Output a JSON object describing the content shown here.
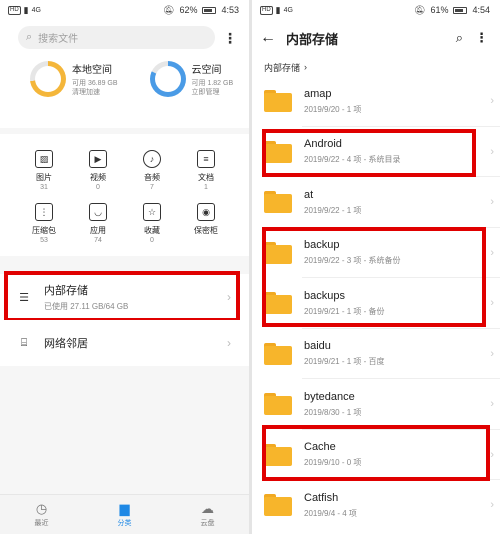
{
  "left_screen": {
    "status": {
      "tag": "HD",
      "net": "4G",
      "battery": "62%",
      "time": "4:53"
    },
    "search": {
      "placeholder": "搜索文件"
    },
    "storage": [
      {
        "title": "本地空间",
        "line1": "可用 36.89 GB",
        "line2": "清理加速",
        "ring_color": "#f4b63a",
        "used_fraction": 0.73
      },
      {
        "title": "云空间",
        "line1": "可用 1.82 GB",
        "line2": "立即管理",
        "ring_color": "#4a9be6",
        "used_fraction": 0.82
      }
    ],
    "categories": [
      {
        "label": "图片",
        "count": "31",
        "icon": "image-icon"
      },
      {
        "label": "视频",
        "count": "0",
        "icon": "video-icon"
      },
      {
        "label": "音频",
        "count": "7",
        "icon": "audio-icon"
      },
      {
        "label": "文档",
        "count": "1",
        "icon": "document-icon"
      },
      {
        "label": "压缩包",
        "count": "53",
        "icon": "archive-icon"
      },
      {
        "label": "应用",
        "count": "74",
        "icon": "app-icon"
      },
      {
        "label": "收藏",
        "count": "0",
        "icon": "star-icon"
      },
      {
        "label": "保密柜",
        "count": "",
        "icon": "safe-icon"
      }
    ],
    "internal_storage": {
      "title": "内部存储",
      "subtitle": "已使用 27.11 GB/64 GB"
    },
    "network": {
      "title": "网络邻居"
    },
    "tabs": [
      {
        "label": "最近",
        "icon": "clock-icon",
        "active": false
      },
      {
        "label": "分类",
        "icon": "folder-icon",
        "active": true
      },
      {
        "label": "云盘",
        "icon": "cloud-icon",
        "active": false
      }
    ]
  },
  "right_screen": {
    "status": {
      "tag": "HD",
      "net": "4G",
      "battery": "61%",
      "time": "4:54"
    },
    "title": "内部存储",
    "breadcrumb": "内部存储",
    "files": [
      {
        "name": "amap",
        "meta": "2019/9/20 - 1 项"
      },
      {
        "name": "Android",
        "meta": "2019/9/22 - 4 项 - 系统目录"
      },
      {
        "name": "at",
        "meta": "2019/9/22 - 1 项"
      },
      {
        "name": "backup",
        "meta": "2019/9/22 - 3 项 - 系统备份"
      },
      {
        "name": "backups",
        "meta": "2019/9/21 - 1 项 - 备份"
      },
      {
        "name": "baidu",
        "meta": "2019/9/21 - 1 项 - 百度"
      },
      {
        "name": "bytedance",
        "meta": "2019/8/30 - 1 项"
      },
      {
        "name": "Cache",
        "meta": "2019/9/10 - 0 项"
      },
      {
        "name": "Catfish",
        "meta": "2019/9/4 - 4 项"
      }
    ]
  },
  "colors": {
    "accent": "#1e88e5",
    "highlight": "#e00000",
    "folder": "#f7b52b"
  }
}
